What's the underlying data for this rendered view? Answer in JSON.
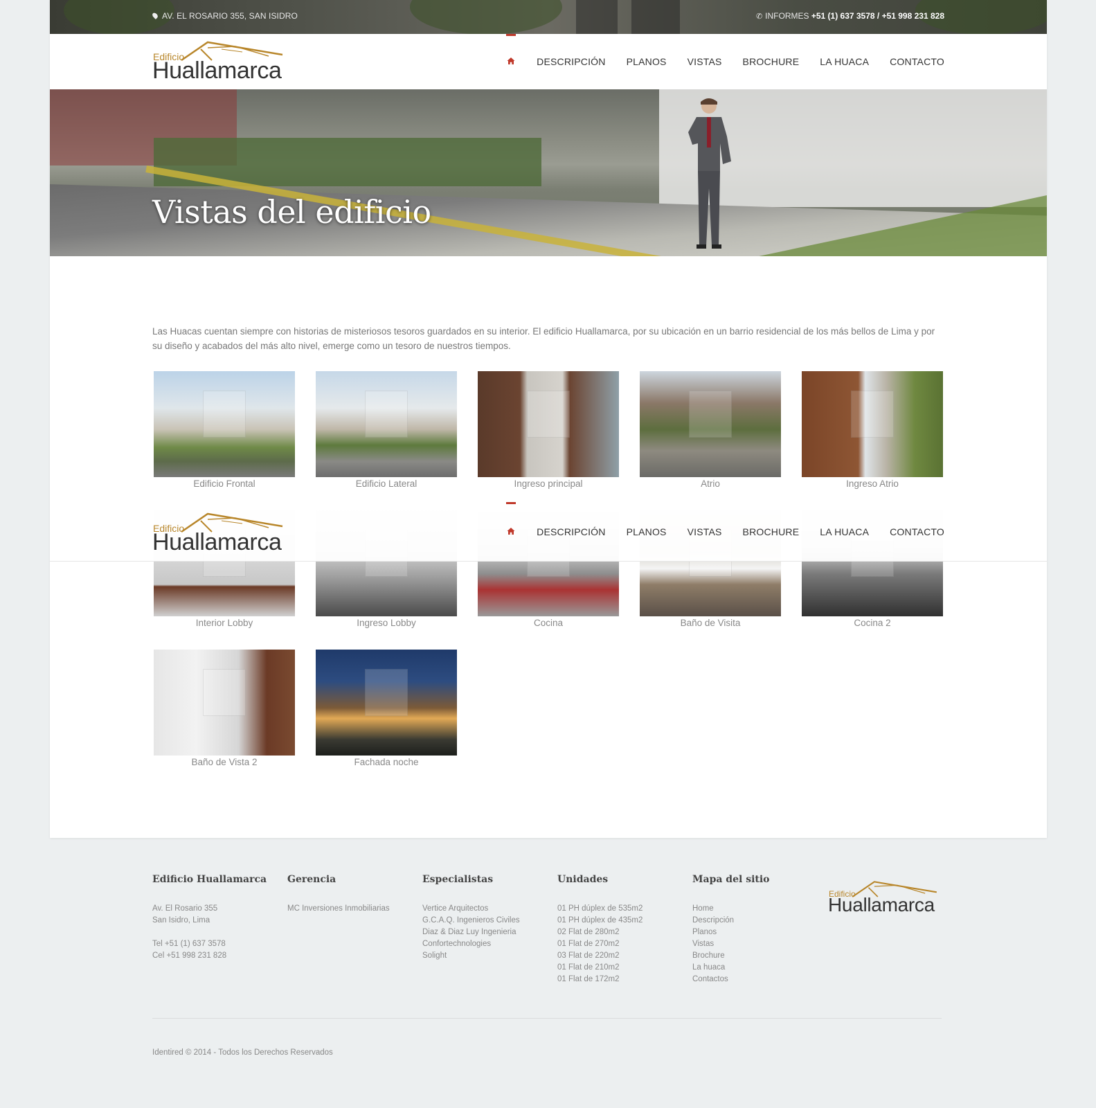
{
  "topbar": {
    "address": "AV. EL ROSARIO 355, SAN ISIDRO",
    "phone_prefix": "INFORMES ",
    "phone_numbers": "+51 (1) 637 3578 / +51 998 231 828"
  },
  "logo": {
    "small": "Edificio",
    "main": "Huallamarca"
  },
  "nav": {
    "items": [
      "DESCRIPCIÓN",
      "PLANOS",
      "VISTAS",
      "BROCHURE",
      "LA HUACA",
      "CONTACTO"
    ],
    "accent": "#c0392b"
  },
  "hero": {
    "title": "Vistas del edificio"
  },
  "intro": "Las Huacas cuentan siempre con historias de misteriosos tesoros guardados en su interior. El edificio Huallamarca, por su ubicación en un barrio residencial de los más bellos de Lima y por su diseño y acabados del más alto nivel, emerge como un tesoro de nuestros tiempos.",
  "gallery": [
    {
      "caption": "Edificio Frontal"
    },
    {
      "caption": "Edificio Lateral"
    },
    {
      "caption": "Ingreso principal"
    },
    {
      "caption": "Atrio"
    },
    {
      "caption": "Ingreso Atrio"
    },
    {
      "caption": "Interior Lobby"
    },
    {
      "caption": "Ingreso Lobby"
    },
    {
      "caption": "Cocina"
    },
    {
      "caption": "Baño de Visita"
    },
    {
      "caption": "Cocina 2"
    },
    {
      "caption": "Baño de Vista 2"
    },
    {
      "caption": "Fachada noche"
    }
  ],
  "footer": {
    "col1": {
      "title": "Edificio Huallamarca",
      "lines": [
        "Av. El Rosario 355",
        "San Isidro, Lima",
        "",
        "Tel +51 (1) 637 3578",
        "Cel +51 998 231 828"
      ]
    },
    "col2": {
      "title": "Gerencia",
      "lines": [
        "MC Inversiones Inmobiliarias"
      ]
    },
    "col3": {
      "title": "Especialistas",
      "lines": [
        "Vertice Arquitectos",
        "G.C.A.Q. Ingenieros Civiles",
        "Diaz & Diaz Luy Ingenieria",
        "Confortechnologies",
        "Solight"
      ]
    },
    "col4": {
      "title": "Unidades",
      "lines": [
        "01 PH dúplex de 535m2",
        "01 PH dúplex de 435m2",
        "02 Flat de 280m2",
        "01 Flat de 270m2",
        "03 Flat de 220m2",
        "01 Flat de 210m2",
        "01 Flat de 172m2"
      ]
    },
    "col5": {
      "title": "Mapa del sitio",
      "lines": [
        "Home",
        "Descripción",
        "Planos",
        "Vistas",
        "Brochure",
        "La huaca",
        "Contactos"
      ]
    },
    "copyright": "Identired © 2014 - Todos los Derechos Reservados"
  }
}
